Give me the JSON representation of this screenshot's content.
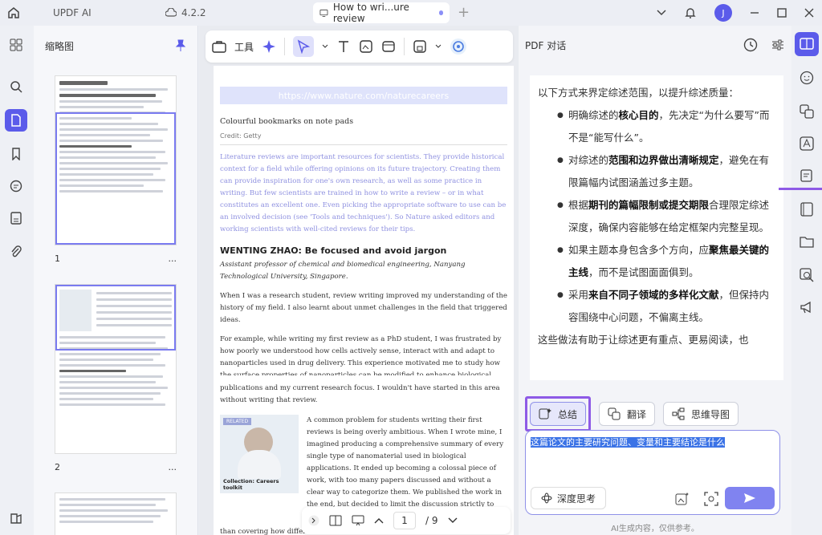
{
  "app": {
    "name": "UPDF AI",
    "version": "4.2.2",
    "tab_title": "How to wri...ure review",
    "user_initial": "J"
  },
  "colors": {
    "accent": "#5b5bea",
    "highlight_box": "#8e5ae6",
    "link_text": "#8f91e0"
  },
  "thumbnails": {
    "title": "缩略图",
    "pages": [
      {
        "label": "1",
        "more": "..."
      },
      {
        "label": "2",
        "more": "..."
      }
    ]
  },
  "toolbar": {
    "tools_label": "工具"
  },
  "document": {
    "url_text": "https://www.nature.com/naturecareers",
    "image_alt": "Colourful bookmarks on note pads",
    "credit": "Credit: Getty",
    "intro": "Literature reviews are important resources for scientists. They provide historical context for a field while offering opinions on its future trajectory. Creating them can provide inspiration for one's own research, as well as some practice in writing. But few scientists are trained in how to write a review – or in what constitutes an excellent one. Even picking the appropriate software to use can be an involved decision (see 'Tools and techniques'). So Nature asked editors and working scientists with well-cited reviews for their tips.",
    "heading": "WENTING ZHAO: Be focused and avoid jargon",
    "subtitle": "Assistant professor of chemical and biomedical engineering, Nanyang Technological University, Singapore.",
    "p1": "When I was a research student, review writing improved my understanding of the history of my field. I also learnt about unmet challenges in the field that triggered ideas.",
    "p2": "For example, while writing my first review as a PhD student, I was frustrated by how poorly we understood how cells actively sense, interact with and adapt to nanoparticles used in drug delivery. This experience motivated me to study how the surface properties of nanoparticles can be modified to enhance biological sensing. When I transitioned to my postdoctoral research, this question led me to discover the role of cell-membrane curvature, which led to",
    "p3": "publications and my current research focus. I wouldn't have started in this area without writing that review.",
    "related_tag": "RELATED",
    "related_caption": "Collection: Careers toolkit",
    "p4": "A common problem for students writing their first reviews is being overly ambitious. When I wrote mine, I imagined producing a comprehensive summary of every single type of nanomaterial used in biological applications. It ended up becoming a colossal piece of work, with too many papers discussed and without a clear way to categorize them. We published the work in the end, but decided to limit the discussion strictly to nanoparticles for biological sensing, rather",
    "p5": "than covering how differen"
  },
  "pager": {
    "current": "1",
    "total": "/ 9"
  },
  "chat": {
    "title": "PDF 对话",
    "intro": "以下方式来界定综述范围，以提升综述质量：",
    "bullets": [
      {
        "pre": "明确综述的",
        "bold": "核心目的",
        "post": "，先决定“为什么要写”而不是“能写什么”。"
      },
      {
        "pre": "对综述的",
        "bold": "范围和边界做出清晰规定",
        "post": "，避免在有限篇幅内试图涵盖过多主题。"
      },
      {
        "pre": "根据",
        "bold": "期刊的篇幅限制或提交期限",
        "post": "合理限定综述深度，确保内容能够在给定框架内完整呈现。"
      },
      {
        "pre": "如果主题本身包含多个方向，应",
        "bold": "聚焦最关键的主线",
        "post": "，而不是试图面面俱到。"
      },
      {
        "pre": "采用",
        "bold": "来自不同子领域的多样化文献",
        "post": "，但保持内容围绕中心问题，不偏离主线。"
      }
    ],
    "outro": "这些做法有助于让综述更有重点、更易阅读，也",
    "quick_actions": {
      "summary": "总结",
      "translate": "翻译",
      "mindmap": "思维导图"
    },
    "input_text": "这篇论文的主要研究问题、变量和主要结论是什么",
    "deep_think": "深度思考",
    "disclaimer": "AI生成内容，仅供参考。"
  }
}
